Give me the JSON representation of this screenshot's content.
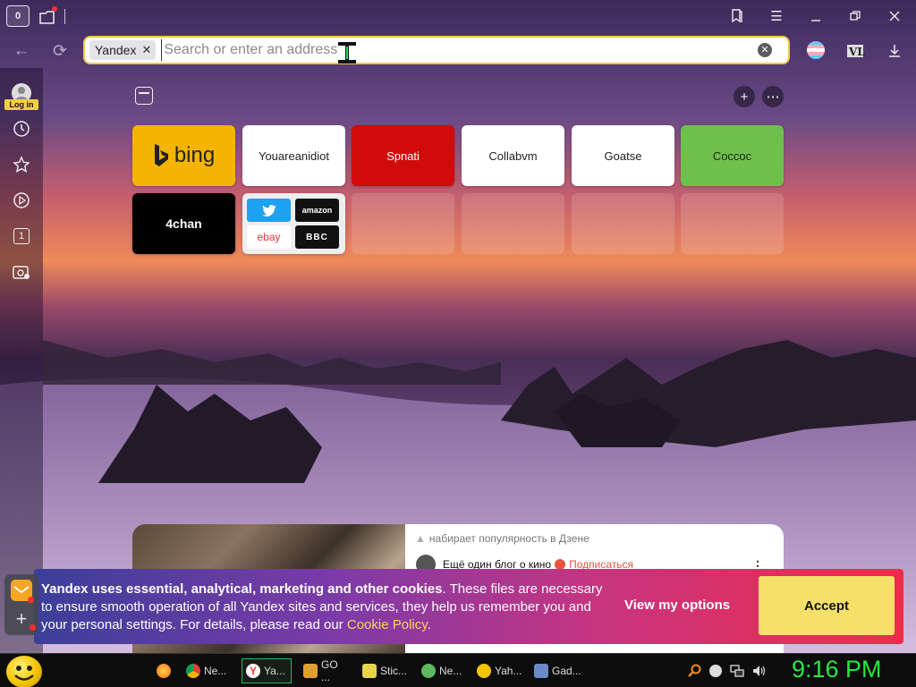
{
  "titlebar": {
    "tab_count": "0",
    "icons": [
      "tabs-icon",
      "new-tab-icon",
      "bookmark-icon",
      "menu-icon",
      "minimize-icon",
      "restore-icon",
      "close-icon"
    ]
  },
  "navbar": {
    "site_chip": "Yandex",
    "search_placeholder": "Search or enter an address",
    "search_value": ""
  },
  "sidebar": {
    "login_label": "Log in",
    "items": [
      "history-icon",
      "favorites-icon",
      "play-icon",
      "tab-count-icon",
      "screenshot-icon"
    ],
    "tab_count_value": "1"
  },
  "tiles": [
    {
      "label": "bing",
      "bg": "#f5b400",
      "color": "#222"
    },
    {
      "label": "Youareanidiot",
      "bg": "#ffffff",
      "color": "#222"
    },
    {
      "label": "Spnati",
      "bg": "#d10a0a",
      "color": "#ffffff"
    },
    {
      "label": "Collabvm",
      "bg": "#ffffff",
      "color": "#222"
    },
    {
      "label": "Goatse",
      "bg": "#ffffff",
      "color": "#222"
    },
    {
      "label": "Coccoc",
      "bg": "#6ec04d",
      "color": "#222"
    },
    {
      "label": "4chan",
      "bg": "#000000",
      "color": "#ffffff"
    }
  ],
  "mixed_tile": {
    "twitter": "",
    "amazon": "amazon",
    "ebay": "ebay",
    "bbc": "BBC"
  },
  "zen": {
    "trending": "набирает популярность в Дзене",
    "title": "Ещё один блог о кино",
    "subscribe": "Подписаться",
    "more": "⋮"
  },
  "cookie": {
    "bold": "Yandex uses essential, analytical, marketing and other cookies",
    "text_start": ". These files are necessary to ensure smooth operation of all Yandex sites and services, they help us remember you and your personal settings. For details, please read our ",
    "link": "Cookie Policy",
    "text_end": ".",
    "view_options": "View my options",
    "accept": "Accept"
  },
  "taskbar": {
    "apps": [
      {
        "label": "",
        "color": "#ff7a1a"
      },
      {
        "label": "Ne...",
        "color": "#4a8df5"
      },
      {
        "label": "Ya...",
        "color": "#ff3b3b"
      },
      {
        "label": "GO ...",
        "color": "#e0a030"
      },
      {
        "label": "Stic...",
        "color": "#e8d44a"
      },
      {
        "label": "Ne...",
        "color": "#5fb85f"
      },
      {
        "label": "Yah...",
        "color": "#f5c400"
      },
      {
        "label": "Gad...",
        "color": "#6a8ac8"
      }
    ],
    "clock": "9:16 PM"
  }
}
